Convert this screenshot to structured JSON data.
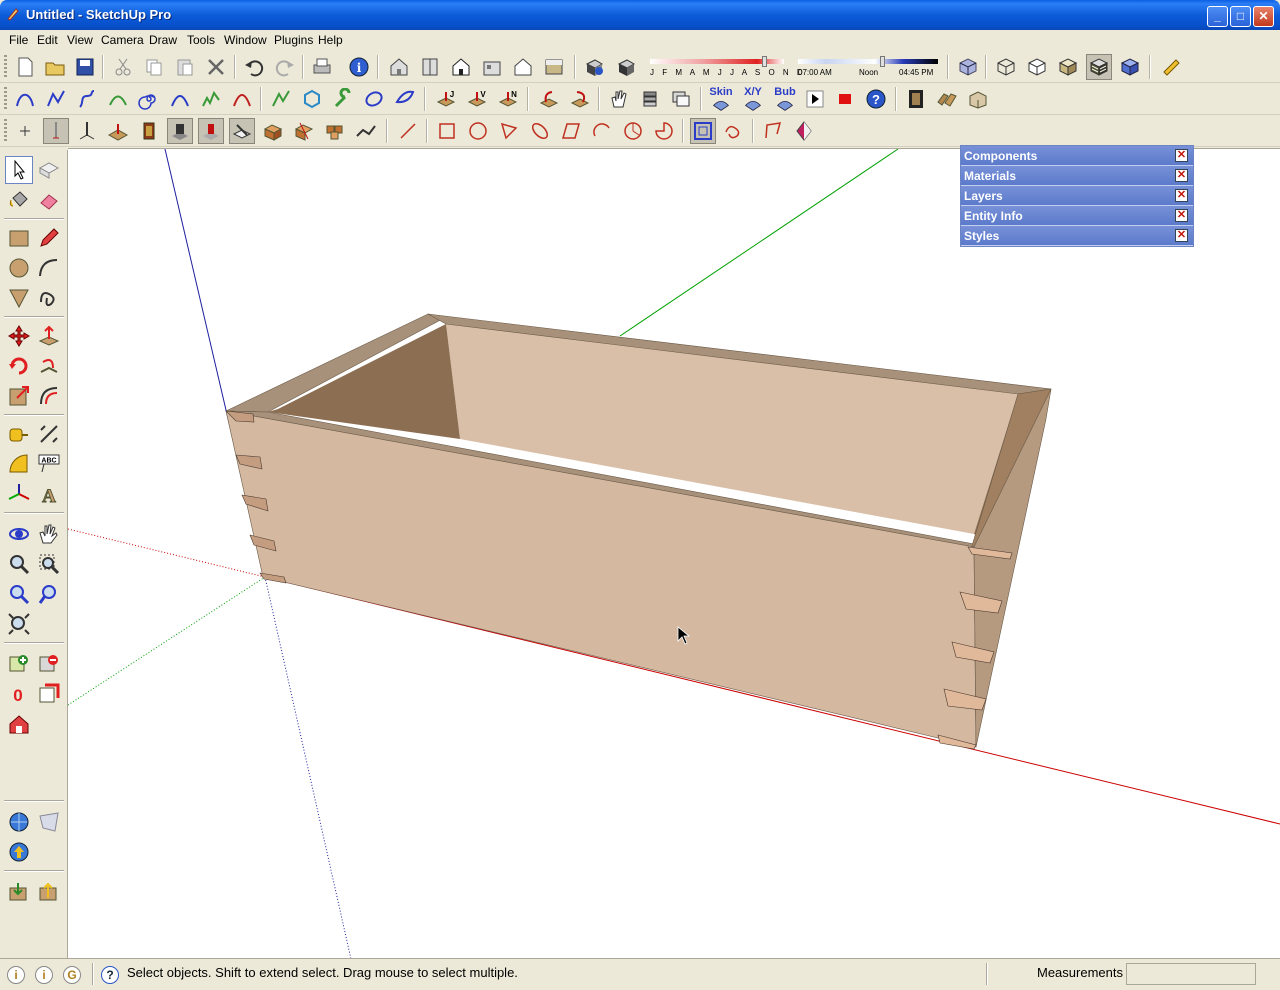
{
  "window": {
    "title": "Untitled - SketchUp Pro"
  },
  "menu": [
    "File",
    "Edit",
    "View",
    "Camera",
    "Draw",
    "Tools",
    "Window",
    "Plugins",
    "Help"
  ],
  "shadow": {
    "months": "J F M A M J J A S O N D",
    "time_start": "07:00 AM",
    "time_mid": "Noon",
    "time_end": "04:45 PM"
  },
  "plugins": {
    "skin": "Skin",
    "xy": "X/Y",
    "bub": "Bub"
  },
  "panels": [
    {
      "label": "Components"
    },
    {
      "label": "Materials"
    },
    {
      "label": "Layers"
    },
    {
      "label": "Entity Info"
    },
    {
      "label": "Styles"
    }
  ],
  "status": {
    "message": "Select objects. Shift to extend select. Drag mouse to select multiple.",
    "measurements_label": "Measurements",
    "measurements_value": ""
  },
  "colors": {
    "titlebar": "#0d5cd9",
    "chrome": "#ece9d8",
    "wood_light": "#d4b8a0",
    "wood_dark": "#8c6e52",
    "axis_red": "#cc0000",
    "axis_green": "#00a000",
    "axis_blue": "#1f1fa0",
    "panel": "#6a85d0"
  }
}
